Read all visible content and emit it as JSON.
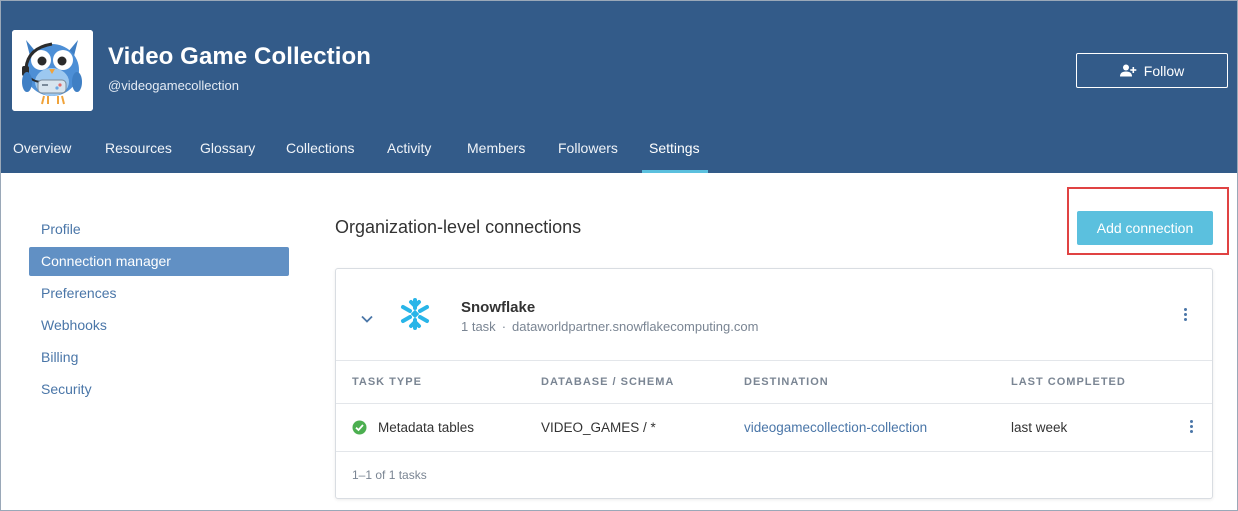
{
  "org": {
    "name": "Video Game Collection",
    "handle": "@videogamecollection",
    "follow_label": "Follow"
  },
  "tabs": [
    {
      "label": "Overview"
    },
    {
      "label": "Resources"
    },
    {
      "label": "Glossary"
    },
    {
      "label": "Collections"
    },
    {
      "label": "Activity"
    },
    {
      "label": "Members"
    },
    {
      "label": "Followers"
    },
    {
      "label": "Settings",
      "active": true
    }
  ],
  "sidebar": {
    "items": [
      {
        "label": "Profile"
      },
      {
        "label": "Connection manager",
        "active": true
      },
      {
        "label": "Preferences"
      },
      {
        "label": "Webhooks"
      },
      {
        "label": "Billing"
      },
      {
        "label": "Security"
      }
    ]
  },
  "main": {
    "title": "Organization-level connections",
    "add_button_label": "Add connection"
  },
  "connection": {
    "name": "Snowflake",
    "task_count": "1 task",
    "separator": "·",
    "host": "dataworldpartner.snowflakecomputing.com",
    "columns": [
      "TASK TYPE",
      "DATABASE / SCHEMA",
      "DESTINATION",
      "LAST COMPLETED"
    ],
    "rows": [
      {
        "task_type": "Metadata tables",
        "database_schema": "VIDEO_GAMES / *",
        "destination": "videogamecollection-collection",
        "last_completed": "last week",
        "status": "success"
      }
    ],
    "pagination": "1–1 of 1 tasks"
  },
  "colors": {
    "header_bg": "#335b89",
    "accent": "#5bc0de",
    "sidebar_active": "#6190c4",
    "link": "#4a76a8",
    "success": "#4caf50",
    "highlight": "#e04343"
  },
  "icons": {
    "follow": "person-plus-icon",
    "expand": "chevron-down-icon",
    "connection": "snowflake-icon",
    "menu": "kebab-menu-icon",
    "status": "check-circle-icon"
  }
}
